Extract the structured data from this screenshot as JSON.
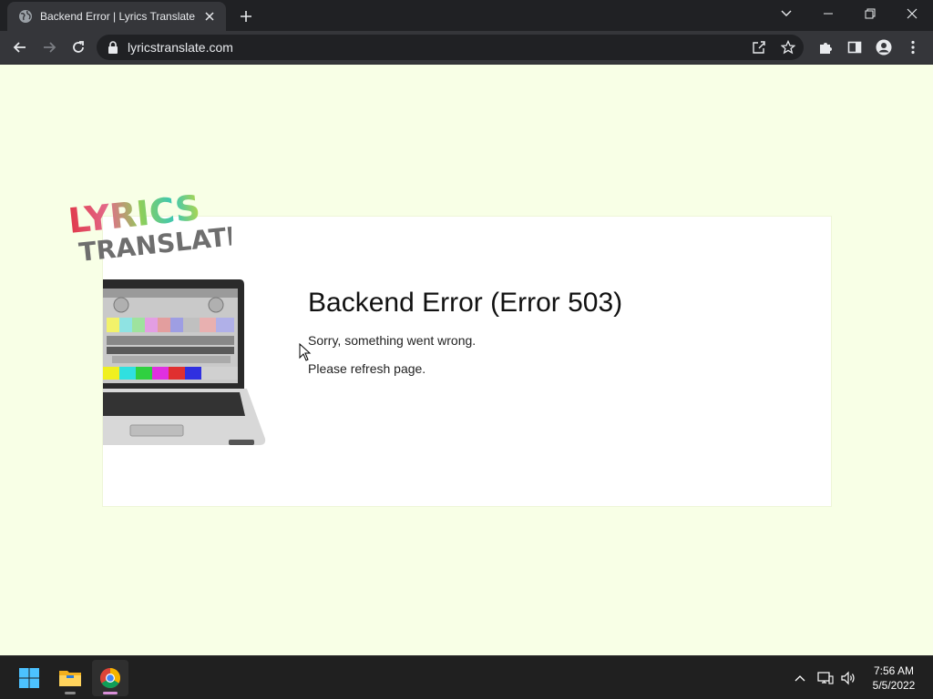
{
  "browser": {
    "tab": {
      "title": "Backend Error | Lyrics Translate"
    },
    "address_bar": {
      "url": "lyricstranslate.com"
    }
  },
  "page": {
    "logo": {
      "line1": "LYRICS",
      "line2": "TRANSLATE"
    },
    "error": {
      "title": "Backend Error (Error 503)",
      "line1": "Sorry, something went wrong.",
      "line2": "Please refresh page."
    },
    "colors": {
      "background": "#f8ffe6",
      "card": "#ffffff"
    }
  },
  "taskbar": {
    "apps": [
      "start-menu",
      "file-explorer",
      "chrome"
    ],
    "clock": {
      "time": "7:56 AM",
      "date": "5/5/2022"
    }
  }
}
